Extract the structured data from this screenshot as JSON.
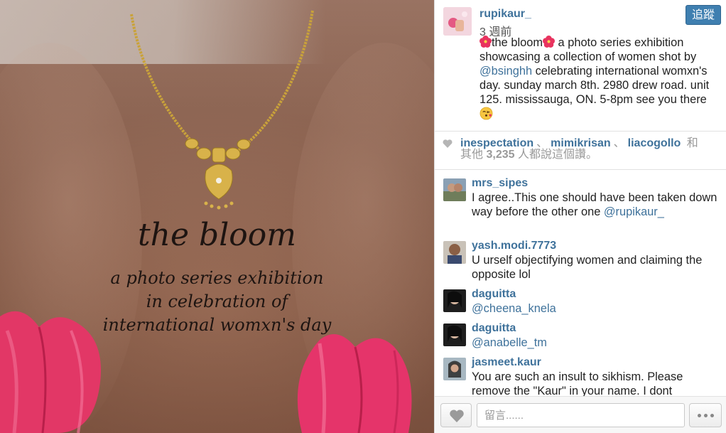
{
  "photo": {
    "title": "the bloom",
    "subtitle_lines": [
      "a photo series exhibition",
      "in celebration of",
      "international womxn's day"
    ]
  },
  "post": {
    "username": "rupikaur_",
    "time": "3 週前",
    "follow_label": "追蹤",
    "caption_parts": {
      "p1": "the bloom",
      "p2": " a photo series exhibition showcasing a collection of women shot by ",
      "mention": "@bsinghh",
      "p3": " celebrating international womxn's day. sunday march 8th. 2980 drew road. unit 125. mississauga, ON. 5-8pm see you there "
    }
  },
  "likes": {
    "users": [
      "inespectation",
      "mimikrisan",
      "liacogollo"
    ],
    "separator": "、",
    "and_label": "和",
    "others_prefix": "其他",
    "count": "3,235",
    "suffix": "人都說這個讚。"
  },
  "comments": [
    {
      "user": "mrs_sipes",
      "text": "I agree..This one should have been taken down way before the other one",
      "mention": "@rupikaur_"
    },
    {
      "user": "yash.modi.7773",
      "text": "U urself objectifying women and claiming the opposite lol",
      "mention": ""
    },
    {
      "user": "daguitta",
      "text": "",
      "mention": "@cheena_knela"
    },
    {
      "user": "daguitta",
      "text": "",
      "mention": "@anabelle_tm"
    },
    {
      "user": "jasmeet.kaur",
      "text": "You are such an insult to sikhism. Please remove the \"Kaur\" in your name. I dont",
      "mention": ""
    }
  ],
  "footer": {
    "comment_placeholder": "留言......"
  },
  "icons": {
    "heart": "heart-icon",
    "more": "more-dots-icon",
    "flower_emoji": "hibiscus-emoji",
    "kiss_emoji": "kiss-emoji"
  },
  "colors": {
    "link_blue": "#3f729b",
    "follow_button": "#3f7fb0",
    "tulip_pink": "#e8336a"
  }
}
